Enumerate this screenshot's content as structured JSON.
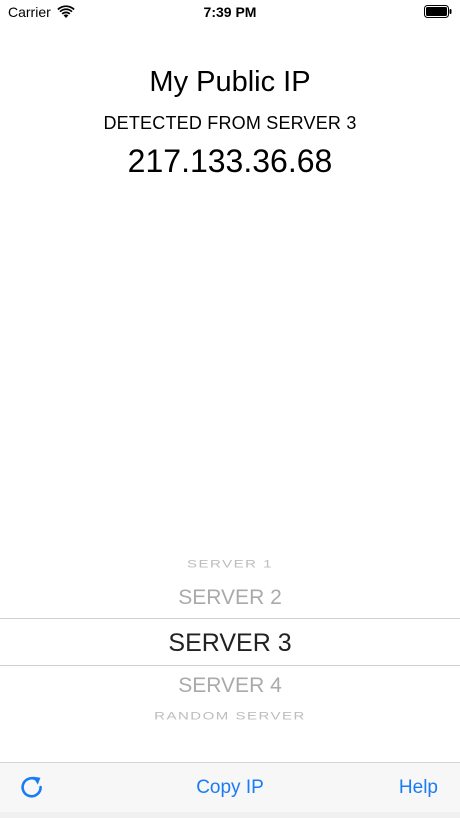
{
  "status_bar": {
    "carrier": "Carrier",
    "time": "7:39 PM"
  },
  "main": {
    "title": "My Public IP",
    "source": "DETECTED FROM SERVER 3",
    "ip": "217.133.36.68"
  },
  "picker": {
    "options": [
      "SERVER 1",
      "SERVER 2",
      "SERVER 3",
      "SERVER 4",
      "RANDOM SERVER"
    ],
    "selected": "SERVER 3"
  },
  "toolbar": {
    "copy_label": "Copy IP",
    "help_label": "Help",
    "refresh_icon": "refresh-icon"
  },
  "colors": {
    "accent": "#1a7cf5",
    "toolbar_bg": "#f7f7f7"
  }
}
